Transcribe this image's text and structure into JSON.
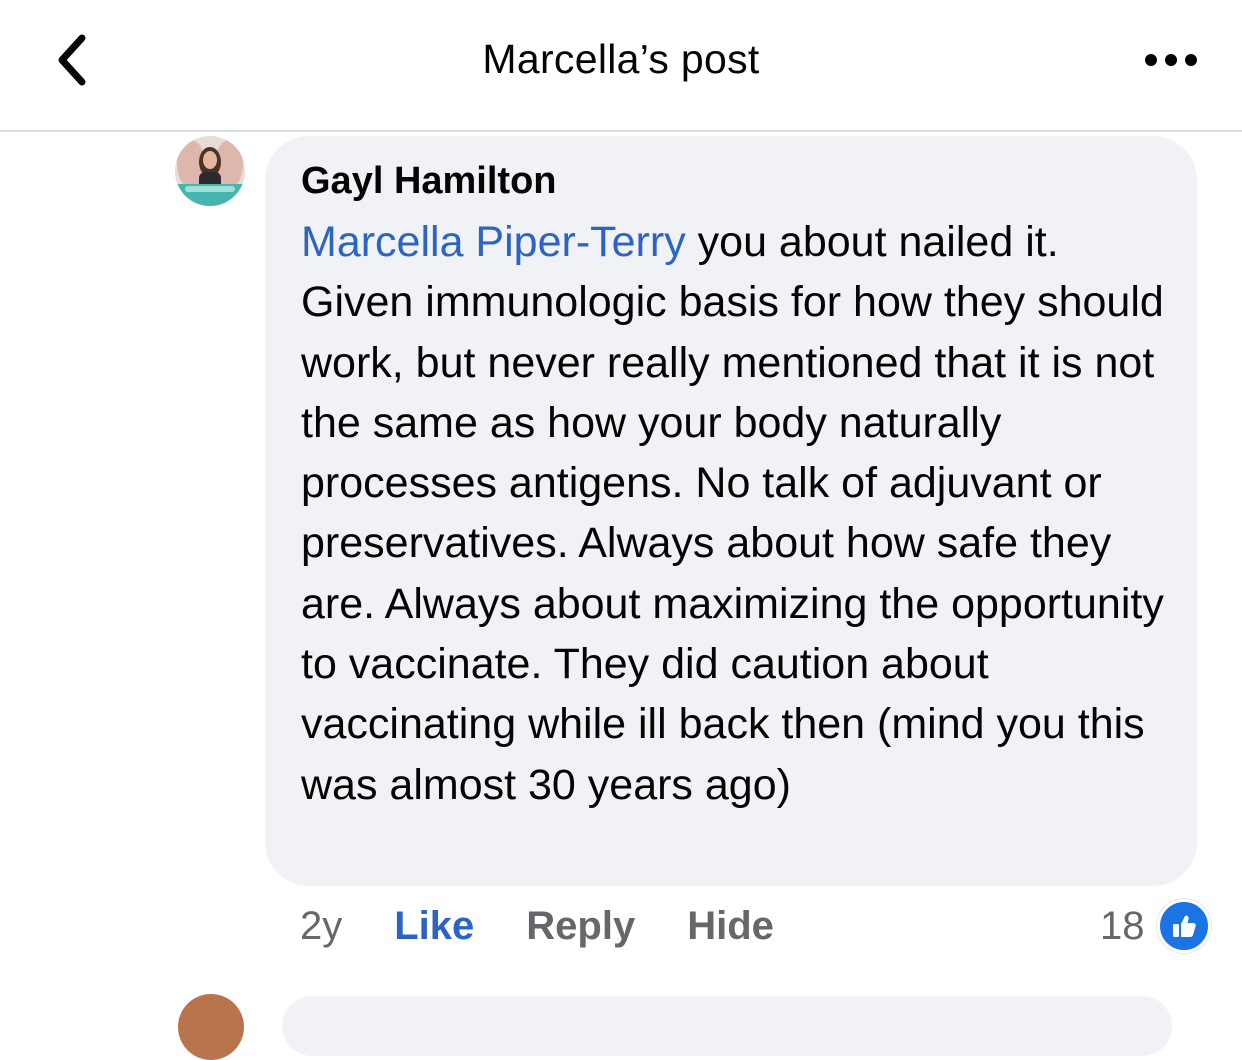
{
  "header": {
    "title": "Marcella’s post",
    "back_icon": "chevron-left-icon",
    "more_icon": "more-horizontal-icon"
  },
  "comment": {
    "author": "Gayl Hamilton",
    "mention": "Marcella Piper-Terry",
    "text": " you about nailed it. Given immunologic basis for how they should work, but never really mentioned that it is not the same as how your body naturally processes antigens. No talk of adjuvant or preservatives. Always about how safe they are. Always about maximizing the opportunity to vaccinate. They did caution about vaccinating while ill back then (mind you this was almost 30 years ago)",
    "age": "2y",
    "like_label": "Like",
    "reply_label": "Reply",
    "hide_label": "Hide",
    "reaction_count": "18",
    "reaction_icon": "thumbs-up-icon"
  },
  "colors": {
    "accent": "#2c64c6",
    "bubble": "#f0f2f5",
    "muted": "#65676b",
    "like_badge": "#1b74e4"
  }
}
